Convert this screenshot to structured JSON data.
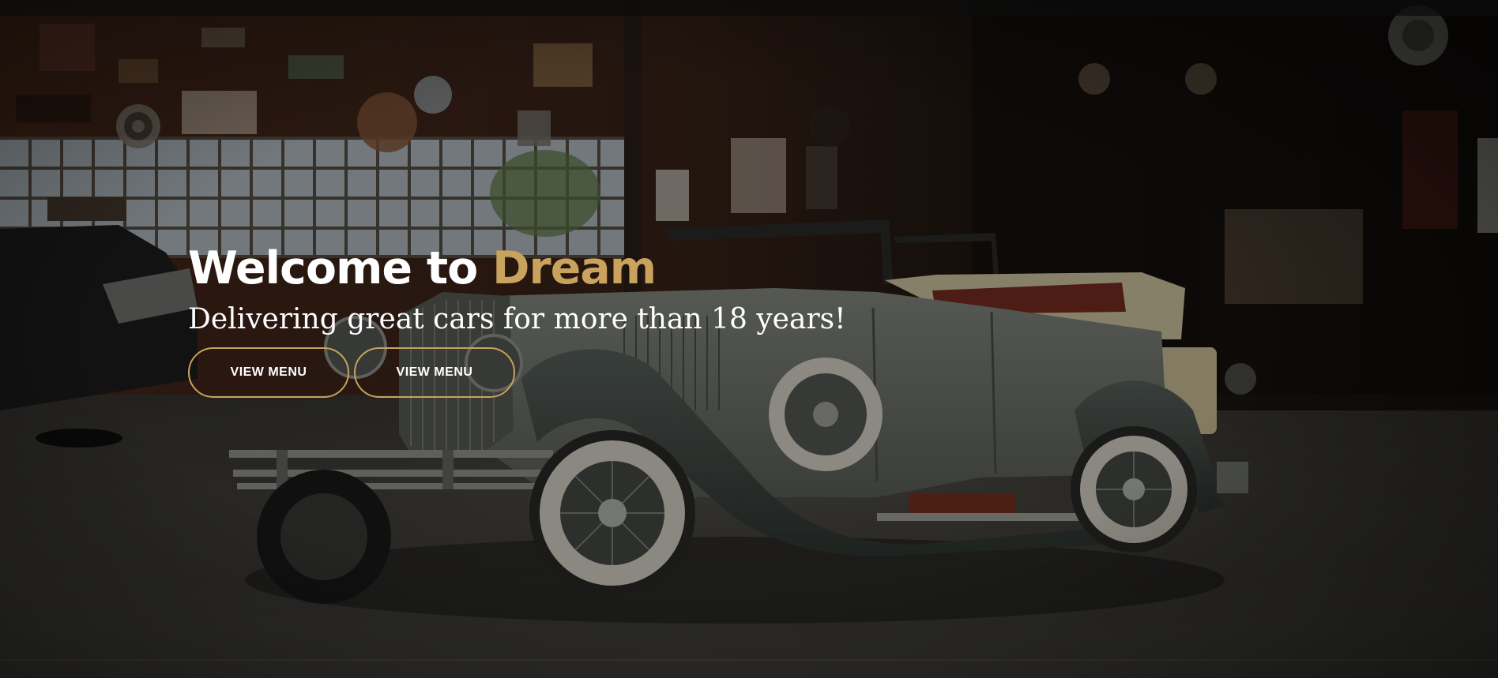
{
  "hero": {
    "title_prefix": "Welcome to ",
    "title_accent": "Dream",
    "subtitle": "Delivering great cars for more than 18 years!",
    "buttons": [
      {
        "label": "VIEW MENU"
      },
      {
        "label": "VIEW MENU"
      }
    ],
    "image_subject": "vintage convertible car in a garage workshop"
  },
  "colors": {
    "accent": "#c9a25d",
    "text": "#ffffff",
    "overlay": "#14110d"
  }
}
